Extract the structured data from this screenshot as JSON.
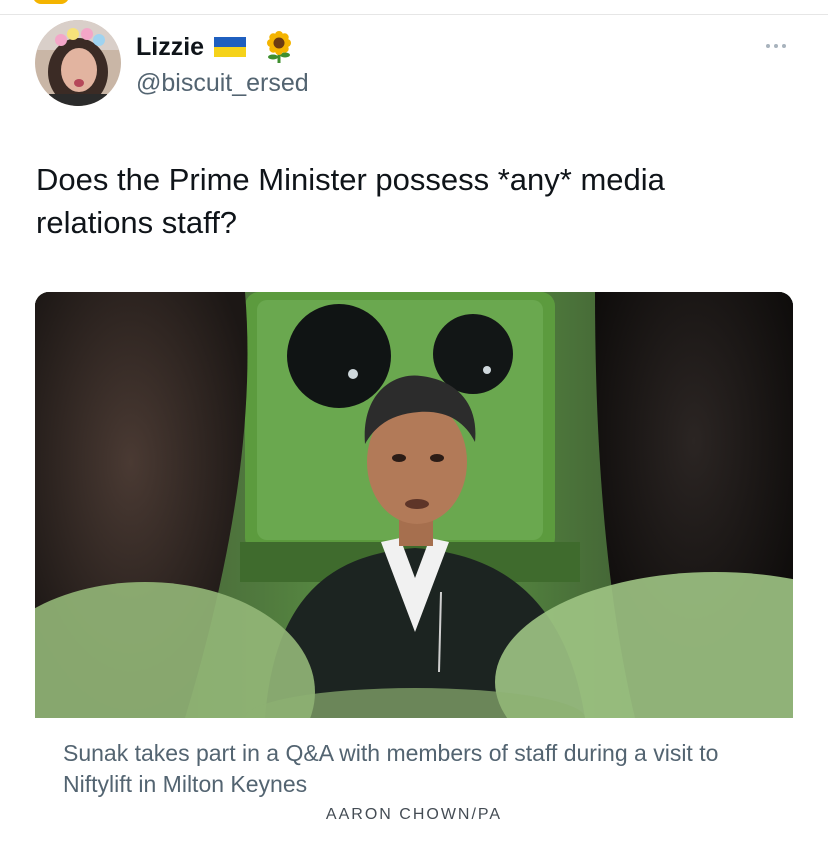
{
  "author": {
    "display_name": "Lizzie",
    "handle": "@biscuit_ersed",
    "badges": [
      "ukraine-flag-icon",
      "sunflower-icon"
    ]
  },
  "tweet": {
    "text": "Does the Prime Minister possess *any* media relations staff?"
  },
  "media": {
    "caption": "Sunak takes part in a Q&A with members of staff during a visit to Niftylift in Milton Keynes",
    "credit": "AARON CHOWN/PA"
  },
  "menu": {
    "icon": "more-horizontal-icon"
  },
  "colors": {
    "text": "#0f1419",
    "secondary": "#536471",
    "flag_blue": "#1f5fbf",
    "flag_yellow": "#f5d21a",
    "machine_green": "#6aa84f"
  }
}
